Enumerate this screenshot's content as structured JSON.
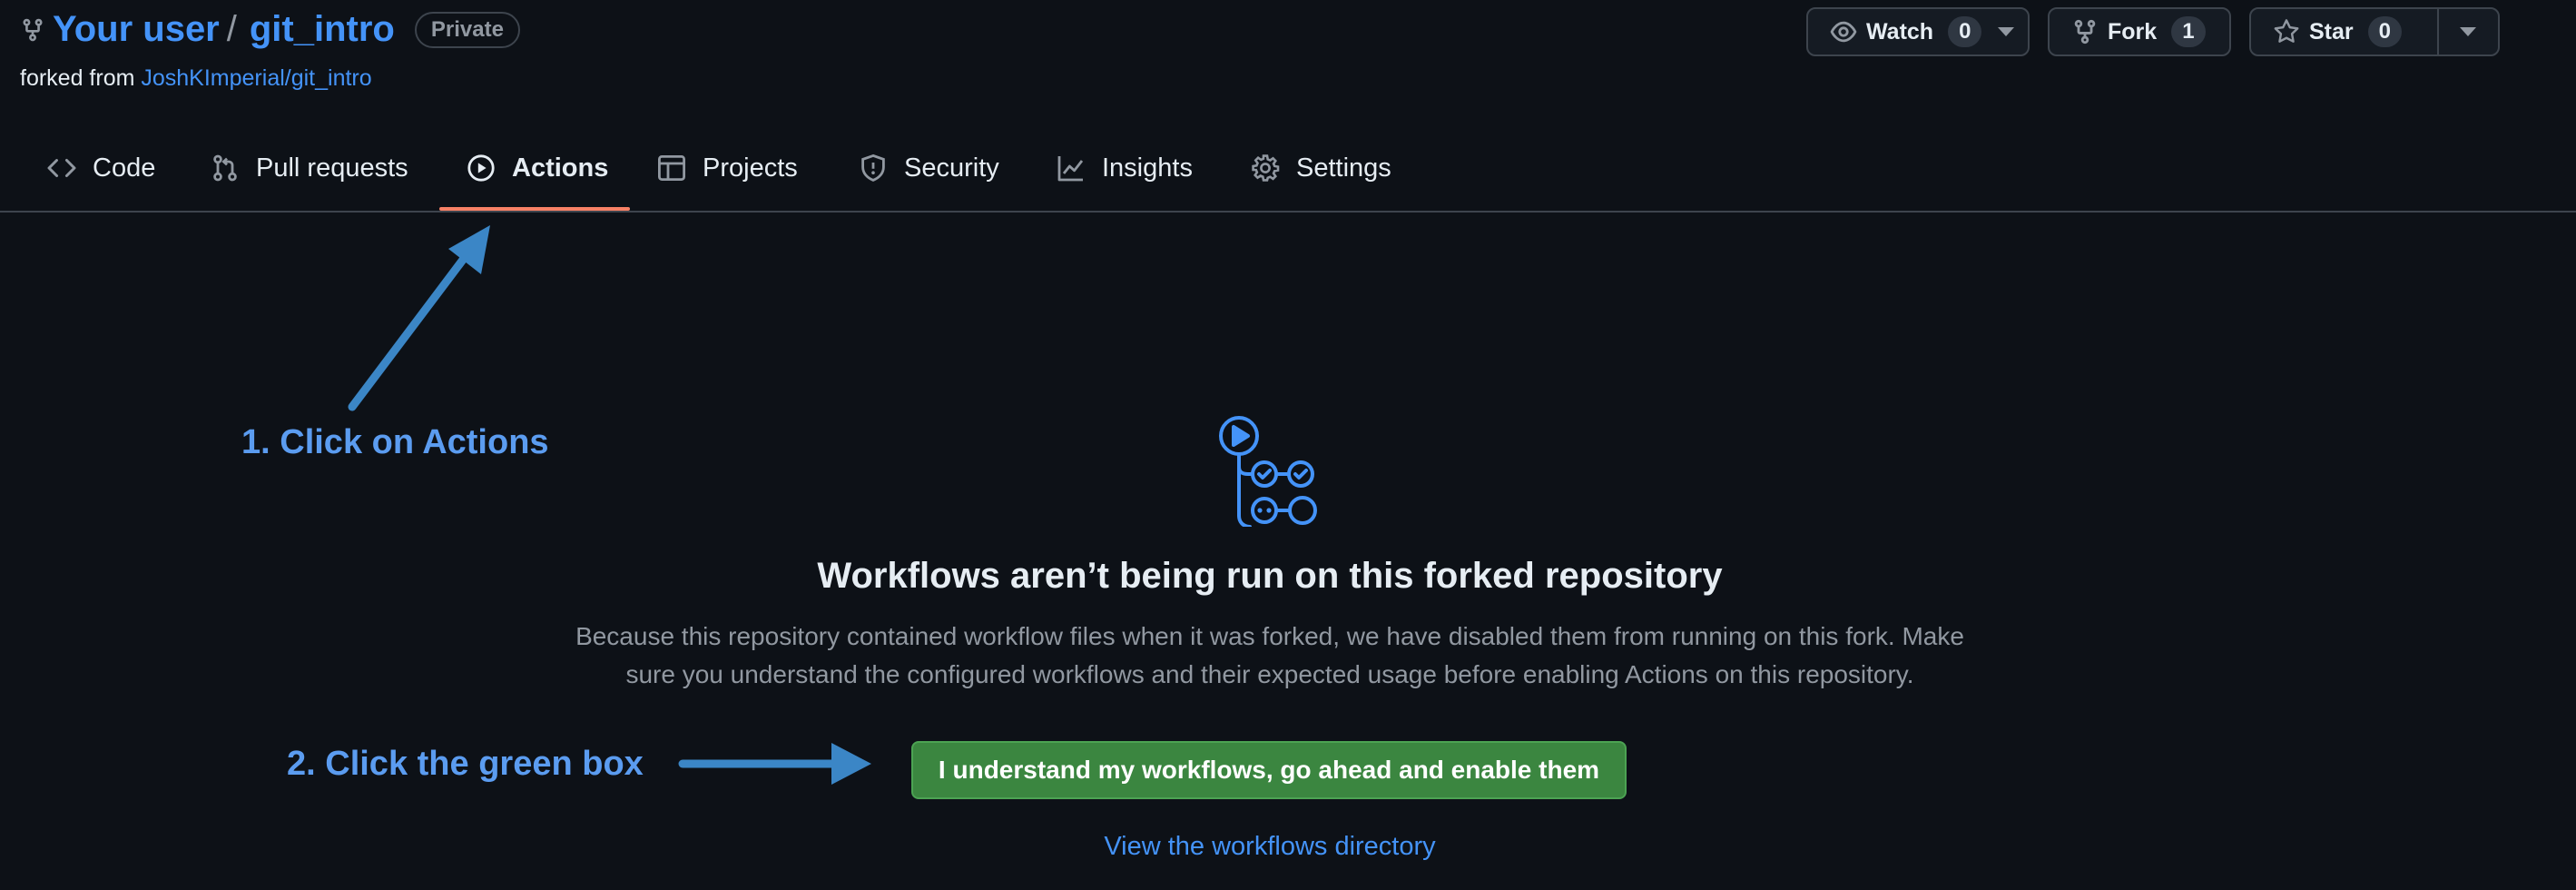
{
  "header": {
    "owner": "Your user",
    "separator": "/",
    "repo": "git_intro",
    "visibility": "Private",
    "forked_prefix": "forked from ",
    "forked_source": "JoshKImperial/git_intro",
    "watch": {
      "label": "Watch",
      "count": "0",
      "icon": "eye-icon"
    },
    "fork": {
      "label": "Fork",
      "count": "1",
      "icon": "repo-forked-icon"
    },
    "star": {
      "label": "Star",
      "count": "0",
      "icon": "star-icon"
    }
  },
  "tabs": [
    {
      "label": "Code",
      "icon": "code-icon"
    },
    {
      "label": "Pull requests",
      "icon": "git-pull-request-icon"
    },
    {
      "label": "Actions",
      "icon": "play-icon",
      "active": true
    },
    {
      "label": "Projects",
      "icon": "table-icon"
    },
    {
      "label": "Security",
      "icon": "shield-icon"
    },
    {
      "label": "Insights",
      "icon": "graph-icon"
    },
    {
      "label": "Settings",
      "icon": "gear-icon"
    }
  ],
  "main": {
    "heading": "Workflows aren’t being run on this forked repository",
    "description_line1": "Because this repository contained workflow files when it was forked, we have disabled them from running on this fork. Make",
    "description_line2": "sure you understand the configured workflows and their expected usage before enabling Actions on this repository.",
    "enable_button": "I understand my workflows, go ahead and enable them",
    "view_link": "View the workflows directory"
  },
  "annotations": {
    "step1": "1. Click on Actions",
    "step2": "2. Click the green box",
    "color": "#5b9cf0"
  },
  "colors": {
    "background": "#0d1117",
    "link": "#4493f8",
    "button_green": "#3b8640",
    "active_tab_underline": "#f78166"
  }
}
